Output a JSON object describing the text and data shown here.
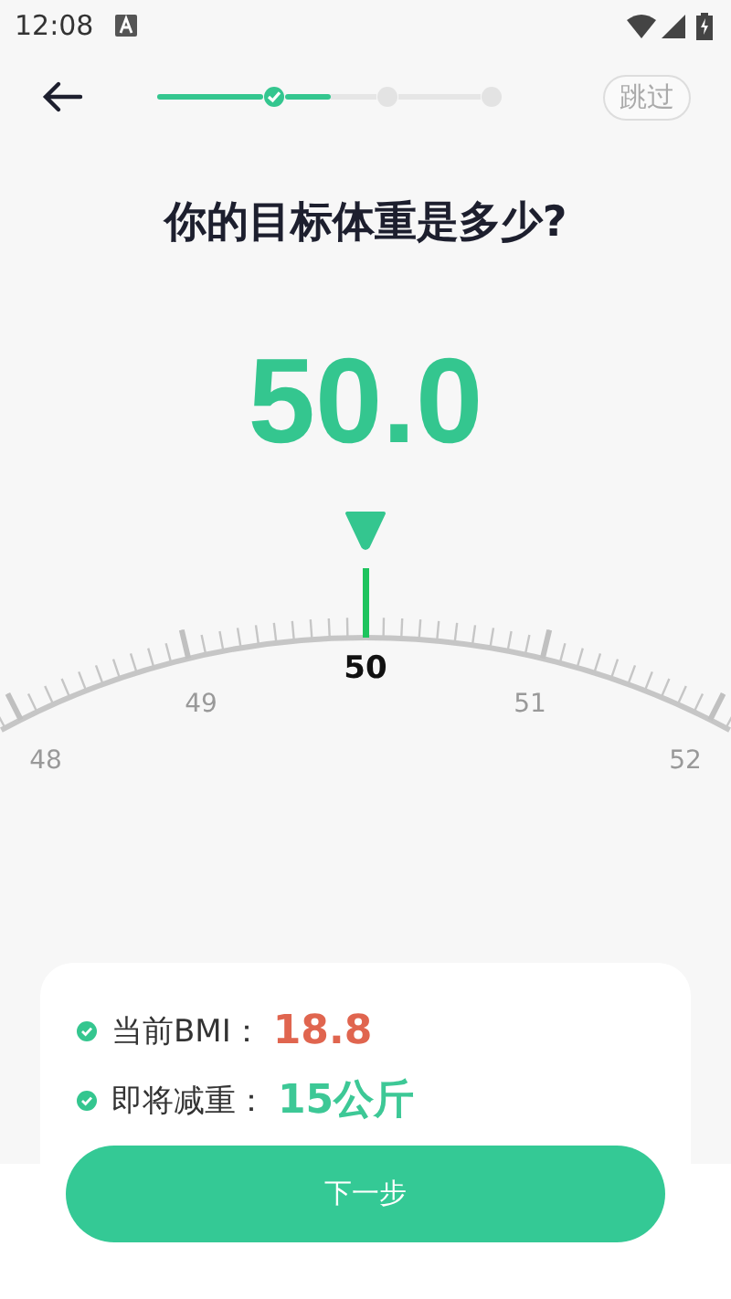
{
  "status_bar": {
    "time": "12:08"
  },
  "header": {
    "skip": "跳过",
    "progress": {
      "steps": [
        {
          "done": true
        },
        {
          "done": false
        },
        {
          "done": false
        }
      ]
    }
  },
  "title": "你的目标体重是多少?",
  "value": "50.0",
  "ruler": {
    "labels": [
      {
        "text": "48",
        "selected": false
      },
      {
        "text": "49",
        "selected": false
      },
      {
        "text": "50",
        "selected": true
      },
      {
        "text": "51",
        "selected": false
      },
      {
        "text": "52",
        "selected": false
      }
    ]
  },
  "summary": [
    {
      "label": "当前BMI：",
      "value": "18.8",
      "color": "#e0654f"
    },
    {
      "label": "即将减重：",
      "value": "15公斤",
      "color": "#3dc896"
    }
  ],
  "next_button": "下一步"
}
